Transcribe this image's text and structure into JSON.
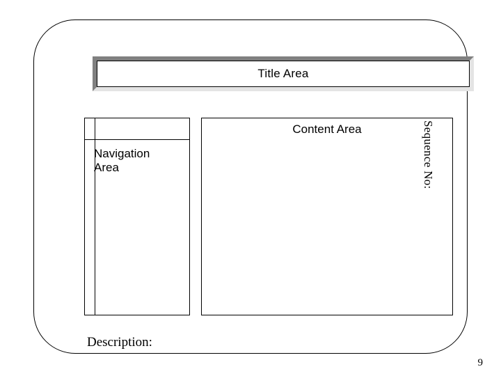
{
  "title": "Title Area",
  "navigation_label": "Navigation\nArea",
  "content_label": "Content Area",
  "sequence_label": "Sequence No:",
  "description_label": "Description:",
  "page_number": "9"
}
